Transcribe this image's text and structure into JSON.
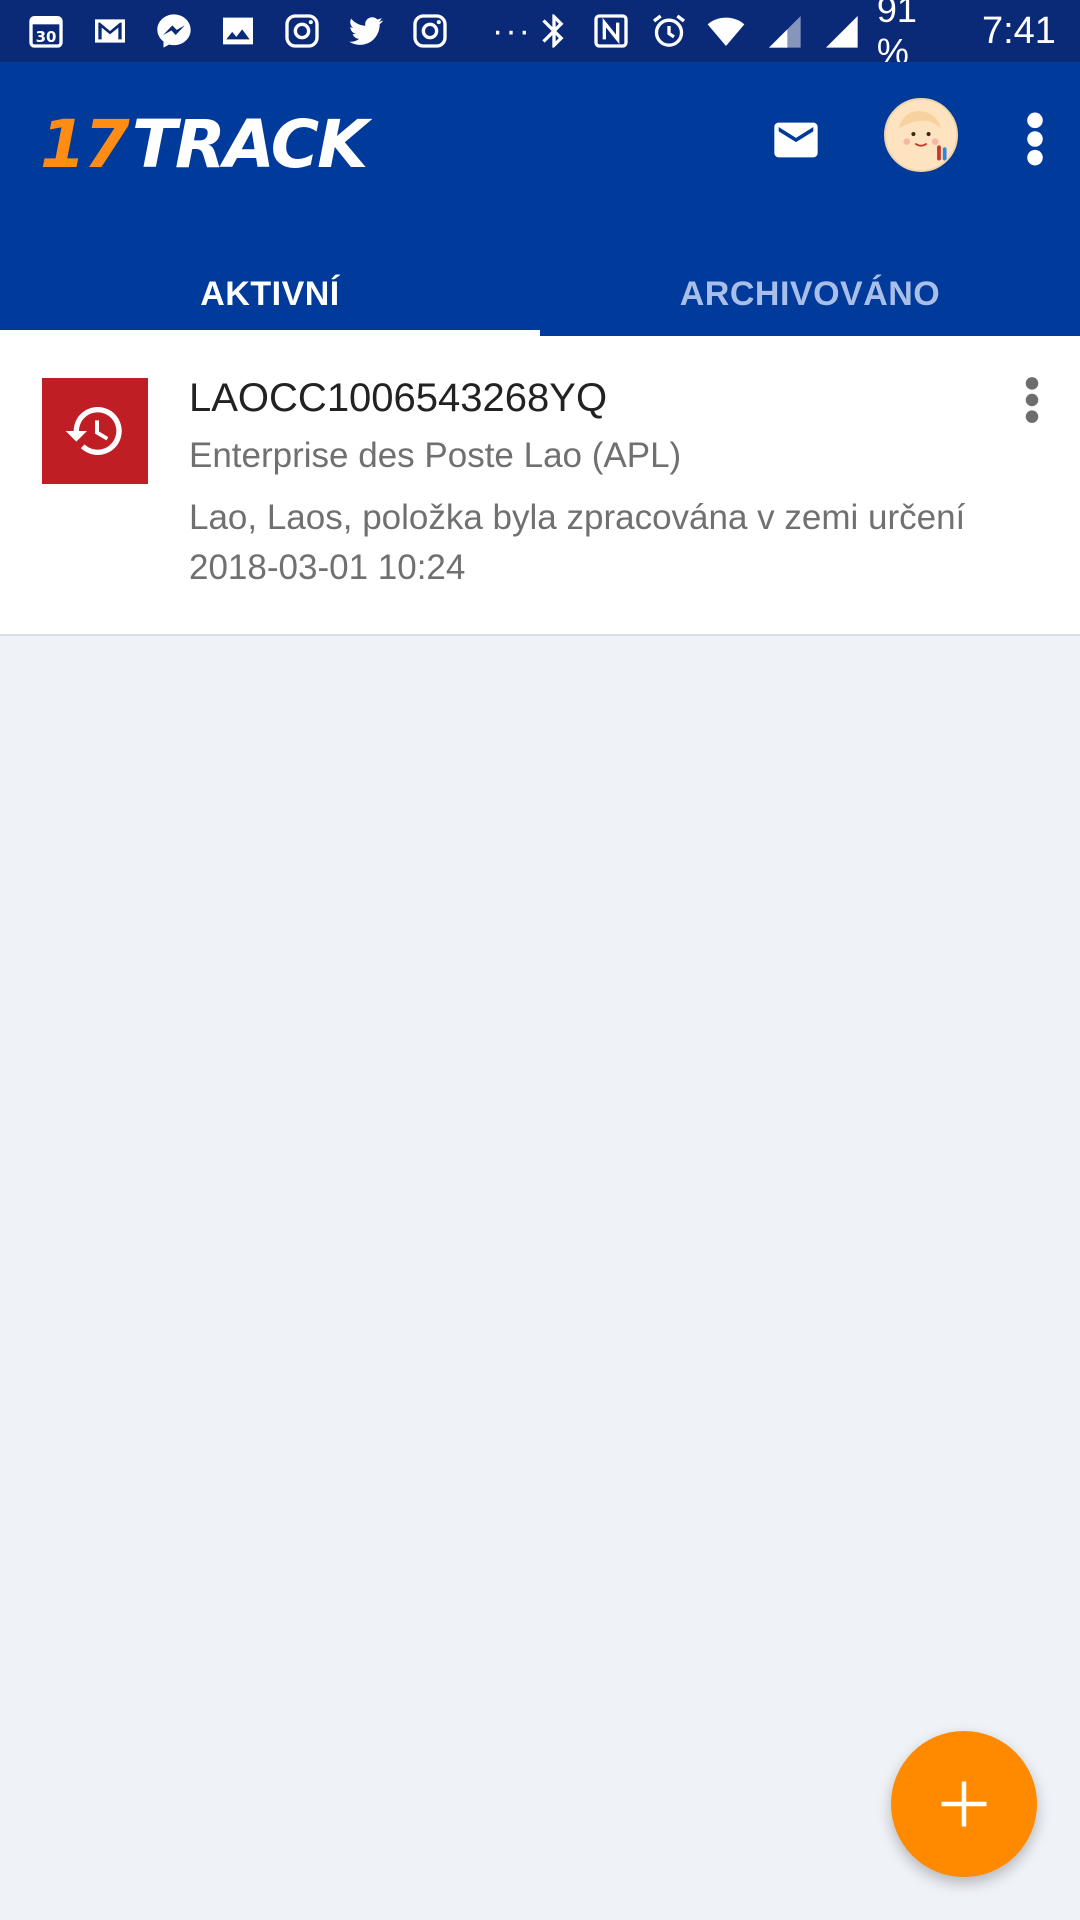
{
  "status_bar": {
    "calendar_day": "30",
    "battery": "91 %",
    "time": "7:41",
    "overflow": "···",
    "icons": [
      "calendar-icon",
      "gmail-icon",
      "messenger-icon",
      "gallery-icon",
      "instagram-icon",
      "twitter-icon",
      "instagram-icon",
      "bluetooth-icon",
      "nfc-icon",
      "alarm-icon",
      "wifi-icon",
      "signal-icon",
      "signal-icon"
    ]
  },
  "app_bar": {
    "logo_number": "17",
    "logo_text": "TRACK",
    "icons": [
      "mail-icon",
      "avatar",
      "more-vert-icon"
    ],
    "brand_color": "#003a9b",
    "accent_color": "#ff8c14"
  },
  "tabs": [
    {
      "label": "AKTIVNÍ",
      "active": true
    },
    {
      "label": "ARCHIVOVÁNO",
      "active": false
    }
  ],
  "packages": [
    {
      "tracking_number": "LAOCC1006543268YQ",
      "carrier": "Enterprise des Poste Lao (APL)",
      "last_event": "Lao, Laos, položka byla zpracována v zemi určení",
      "last_event_time": "2018-03-01 10:24",
      "status_icon": "history-icon",
      "status_color": "#bf1e24"
    }
  ],
  "fab": {
    "icon": "plus-icon",
    "color": "#ff8a00"
  }
}
